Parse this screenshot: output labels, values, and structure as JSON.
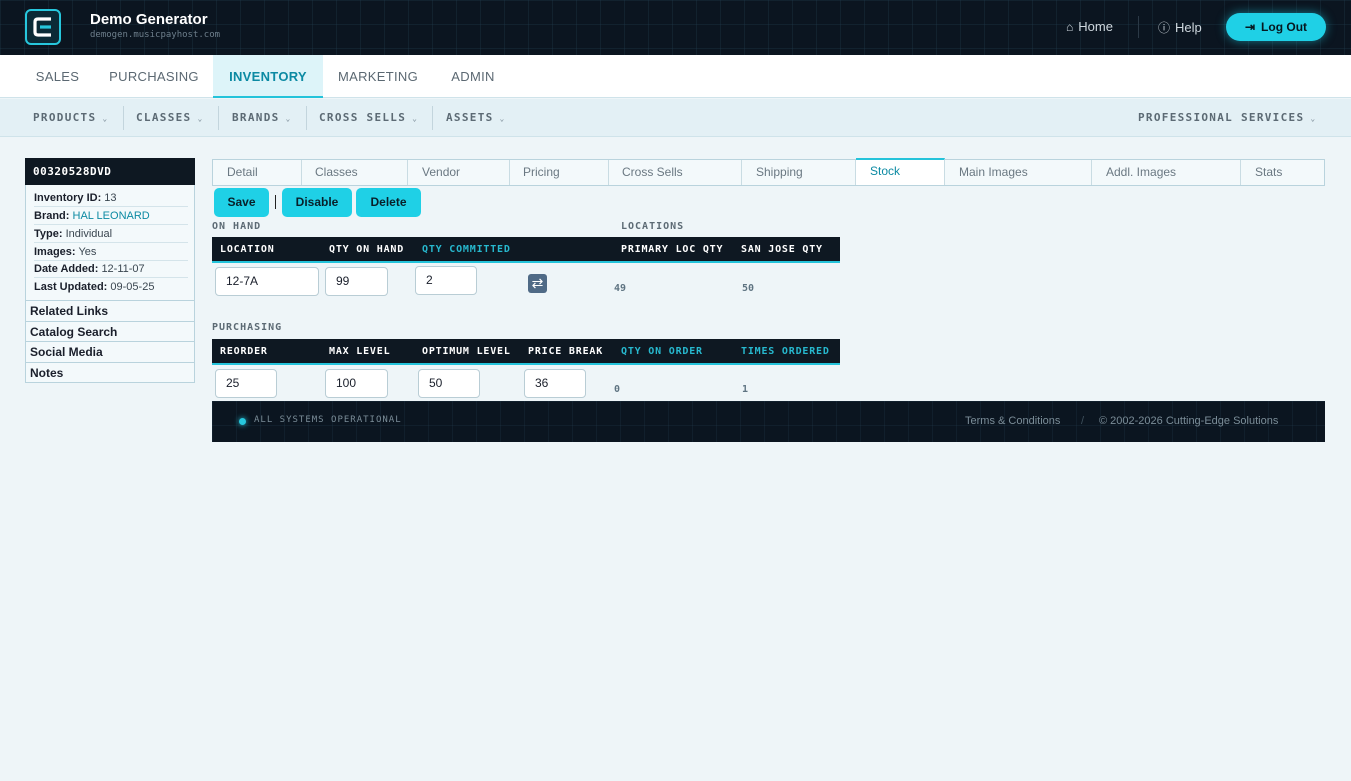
{
  "header": {
    "title": "Demo Generator",
    "subtitle": "demogen.musicpayhost.com",
    "home": "Home",
    "help": "Help",
    "logout": "Log Out"
  },
  "mainnav": [
    "SALES",
    "PURCHASING",
    "INVENTORY",
    "MARKETING",
    "ADMIN"
  ],
  "mainnav_active": "INVENTORY",
  "subnav": {
    "products": "PRODUCTS",
    "classes": "CLASSES",
    "brands": "BRANDS",
    "cross_sells": "CROSS SELLS",
    "assets": "ASSETS",
    "professional_services": "PROFESSIONAL SERVICES"
  },
  "product": {
    "sku": "00320528DVD",
    "inventory_id_label": "Inventory ID:",
    "inventory_id": "13",
    "brand_label": "Brand:",
    "brand": "HAL LEONARD",
    "type_label": "Type:",
    "type": "Individual",
    "images_label": "Images:",
    "images": "Yes",
    "date_added_label": "Date Added:",
    "date_added": "12-11-07",
    "last_updated_label": "Last Updated:",
    "last_updated": "09-05-25"
  },
  "sidelinks": {
    "related": "Related Links",
    "catalog": "Catalog Search",
    "social": "Social Media",
    "notes": "Notes"
  },
  "tabs": {
    "detail": "Detail",
    "classes": "Classes",
    "vendor": "Vendor",
    "pricing": "Pricing",
    "cross_sells": "Cross Sells",
    "shipping": "Shipping",
    "stock": "Stock",
    "main_images": "Main Images",
    "addl_images": "Addl. Images",
    "stats": "Stats"
  },
  "actions": {
    "save": "Save",
    "disable": "Disable",
    "delete": "Delete"
  },
  "on_hand": {
    "section": "ON HAND",
    "locations_section": "LOCATIONS",
    "col_location": "LOCATION",
    "col_qty_on_hand": "QTY ON HAND",
    "col_qty_committed": "QTY COMMITTED",
    "col_primary_loc_qty": "PRIMARY LOC QTY",
    "col_san_jose_qty": "SAN JOSE QTY",
    "location": "12-7A",
    "qty_on_hand": "99",
    "qty_committed": "2",
    "primary_loc_qty": "49",
    "san_jose_qty": "50"
  },
  "purchasing": {
    "section": "PURCHASING",
    "col_reorder": "REORDER",
    "col_max_level": "MAX LEVEL",
    "col_optimum_level": "OPTIMUM LEVEL",
    "col_price_break": "PRICE BREAK",
    "col_qty_on_order": "QTY ON ORDER",
    "col_times_ordered": "TIMES ORDERED",
    "reorder": "25",
    "max_level": "100",
    "optimum_level": "50",
    "price_break": "36",
    "qty_on_order": "0",
    "times_ordered": "1"
  },
  "footer": {
    "status": "ALL SYSTEMS OPERATIONAL",
    "terms": "Terms & Conditions",
    "separator": "/",
    "copyright": "© 2002-2026 Cutting-Edge Solutions"
  },
  "colors": {
    "accent": "#1fd0e6",
    "dark": "#0b1520",
    "link": "#0c8aa3"
  }
}
